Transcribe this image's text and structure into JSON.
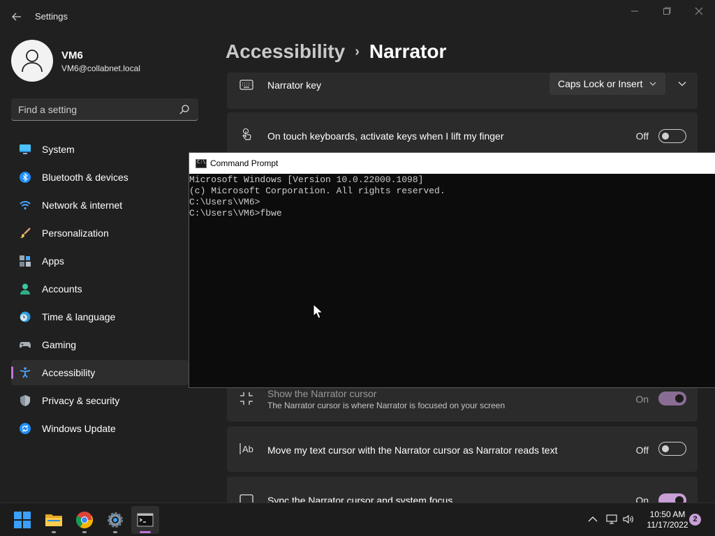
{
  "window": {
    "app_title": "Settings",
    "back_icon": "arrow-left-icon",
    "controls": [
      "minimize",
      "maximize",
      "close"
    ]
  },
  "profile": {
    "name": "VM6",
    "email": "VM6@collabnet.local"
  },
  "search": {
    "placeholder": "Find a setting",
    "value": ""
  },
  "sidebar": {
    "items": [
      {
        "label": "System",
        "icon": "monitor-icon",
        "active": false
      },
      {
        "label": "Bluetooth & devices",
        "icon": "bluetooth-icon",
        "active": false
      },
      {
        "label": "Network & internet",
        "icon": "wifi-icon",
        "active": false
      },
      {
        "label": "Personalization",
        "icon": "brush-icon",
        "active": false
      },
      {
        "label": "Apps",
        "icon": "apps-icon",
        "active": false
      },
      {
        "label": "Accounts",
        "icon": "person-icon",
        "active": false
      },
      {
        "label": "Time & language",
        "icon": "globe-clock-icon",
        "active": false
      },
      {
        "label": "Gaming",
        "icon": "gamepad-icon",
        "active": false
      },
      {
        "label": "Accessibility",
        "icon": "accessibility-icon",
        "active": true
      },
      {
        "label": "Privacy & security",
        "icon": "shield-icon",
        "active": false
      },
      {
        "label": "Windows Update",
        "icon": "update-icon",
        "active": false
      }
    ]
  },
  "breadcrumb": {
    "parent": "Accessibility",
    "separator": "›",
    "current": "Narrator"
  },
  "settings": {
    "narrator_key": {
      "title": "Narrator key",
      "value": "Caps Lock or Insert"
    },
    "touch_keyboard": {
      "title": "On touch keyboards, activate keys when I lift my finger",
      "state": "Off"
    },
    "show_cursor": {
      "title": "Show the Narrator cursor",
      "subtitle": "The Narrator cursor is where Narrator is focused on your screen",
      "state": "On"
    },
    "move_text_cursor": {
      "title": "Move my text cursor with the Narrator cursor as Narrator reads text",
      "state": "Off"
    },
    "sync_focus": {
      "title": "Sync the Narrator cursor and system focus",
      "state": "On"
    }
  },
  "cmd": {
    "title": "Command Prompt",
    "icon_text": "C:\\",
    "lines": [
      "Microsoft Windows [Version 10.0.22000.1098]",
      "(c) Microsoft Corporation. All rights reserved.",
      "C:\\Users\\VM6>",
      "C:\\Users\\VM6>fbwe"
    ]
  },
  "taskbar": {
    "apps": [
      "start-icon",
      "file-explorer-icon",
      "chrome-icon",
      "settings-gear-icon",
      "command-prompt-icon"
    ],
    "clock": {
      "time": "10:50 AM",
      "date": "11/17/2022"
    },
    "notification_count": "2"
  },
  "colors": {
    "accent": "#c074d8",
    "toggle_on": "#c89fd6",
    "background": "#202020",
    "card": "#2b2b2b"
  }
}
